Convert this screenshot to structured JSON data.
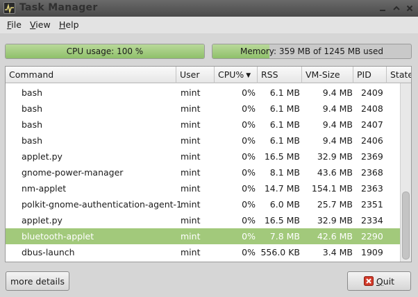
{
  "window": {
    "title": "Task Manager"
  },
  "menu": [
    {
      "label": "File",
      "accel": "F",
      "rest": "ile"
    },
    {
      "label": "View",
      "accel": "V",
      "rest": "iew"
    },
    {
      "label": "Help",
      "accel": "H",
      "rest": "elp"
    }
  ],
  "cpu": {
    "label": "CPU usage: 100 %",
    "fraction": 1.0
  },
  "memory": {
    "label": "Memory: 359 MB of 1245 MB used",
    "fraction": 0.288
  },
  "columns": {
    "command": "Command",
    "user": "User",
    "cpu": "CPU%",
    "rss": "RSS",
    "vm": "VM-Size",
    "pid": "PID",
    "state": "State"
  },
  "processes": [
    {
      "command": "bash",
      "user": "mint",
      "cpu": "0%",
      "rss": "6.1 MB",
      "vm": "9.4 MB",
      "pid": "2409",
      "selected": false
    },
    {
      "command": "bash",
      "user": "mint",
      "cpu": "0%",
      "rss": "6.1 MB",
      "vm": "9.4 MB",
      "pid": "2408",
      "selected": false
    },
    {
      "command": "bash",
      "user": "mint",
      "cpu": "0%",
      "rss": "6.1 MB",
      "vm": "9.4 MB",
      "pid": "2407",
      "selected": false
    },
    {
      "command": "bash",
      "user": "mint",
      "cpu": "0%",
      "rss": "6.1 MB",
      "vm": "9.4 MB",
      "pid": "2406",
      "selected": false
    },
    {
      "command": "applet.py",
      "user": "mint",
      "cpu": "0%",
      "rss": "16.5 MB",
      "vm": "32.9 MB",
      "pid": "2369",
      "selected": false
    },
    {
      "command": "gnome-power-manager",
      "user": "mint",
      "cpu": "0%",
      "rss": "8.1 MB",
      "vm": "43.6 MB",
      "pid": "2368",
      "selected": false
    },
    {
      "command": "nm-applet",
      "user": "mint",
      "cpu": "0%",
      "rss": "14.7 MB",
      "vm": "154.1 MB",
      "pid": "2363",
      "selected": false
    },
    {
      "command": "polkit-gnome-authentication-agent-1",
      "user": "mint",
      "cpu": "0%",
      "rss": "6.0 MB",
      "vm": "25.7 MB",
      "pid": "2351",
      "selected": false
    },
    {
      "command": "applet.py",
      "user": "mint",
      "cpu": "0%",
      "rss": "16.5 MB",
      "vm": "32.9 MB",
      "pid": "2334",
      "selected": false
    },
    {
      "command": "bluetooth-applet",
      "user": "mint",
      "cpu": "0%",
      "rss": "7.8 MB",
      "vm": "42.6 MB",
      "pid": "2290",
      "selected": true
    },
    {
      "command": "dbus-launch",
      "user": "mint",
      "cpu": "0%",
      "rss": "556.0 KB",
      "vm": "3.4 MB",
      "pid": "1909",
      "selected": false
    }
  ],
  "buttons": {
    "details": "more details",
    "quit_accel": "Q",
    "quit_rest": "uit"
  }
}
